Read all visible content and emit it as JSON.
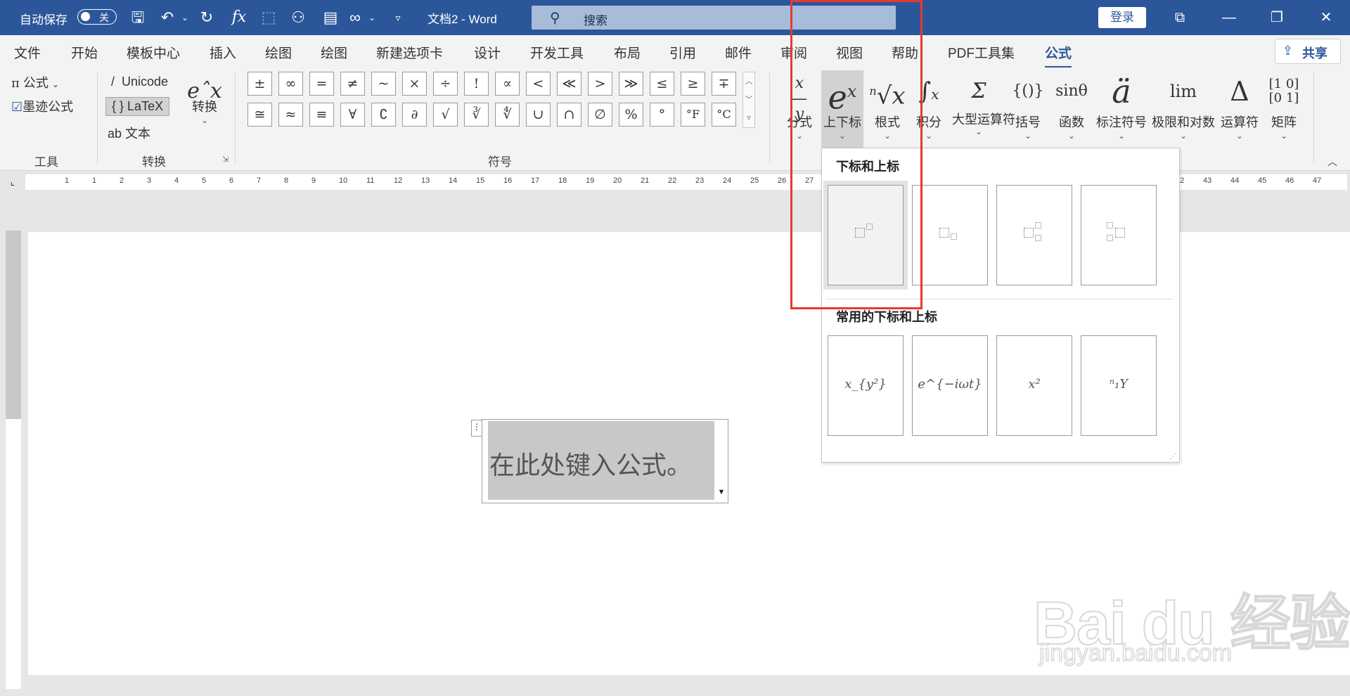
{
  "titlebar": {
    "autosave_label": "自动保存",
    "autosave_state": "关",
    "doc_title": "文档2  -  Word",
    "search_placeholder": "搜索",
    "login_label": "登录"
  },
  "tabs": [
    "文件",
    "开始",
    "模板中心",
    "插入",
    "绘图",
    "绘图",
    "新建选项卡",
    "设计",
    "开发工具",
    "布局",
    "引用",
    "邮件",
    "审阅",
    "视图",
    "帮助",
    "PDF工具集",
    "公式"
  ],
  "active_tab": "公式",
  "share_label": "共享",
  "ribbon": {
    "tools": {
      "formula_label": "公式",
      "ink_label": "墨迹公式",
      "group_label": "工具"
    },
    "convert": {
      "unicode_label": "Unicode",
      "latex_label": "LaTeX",
      "text_label": "文本",
      "convert_label": "转换",
      "group_label": "转换"
    },
    "symbols": {
      "row1": [
        "±",
        "∞",
        "=",
        "≠",
        "~",
        "×",
        "÷",
        "!",
        "∝",
        "<",
        "≪",
        ">",
        "≫",
        "≤",
        "≥",
        "∓"
      ],
      "row2": [
        "≅",
        "≈",
        "≡",
        "∀",
        "∁",
        "∂",
        "√",
        "∛",
        "∜",
        "∪",
        "∩",
        "∅",
        "%",
        "°",
        "°F",
        "°C"
      ],
      "group_label": "符号"
    },
    "structures": [
      {
        "label": "分式",
        "glyph": "x/y"
      },
      {
        "label": "上下标",
        "glyph": "eˣ"
      },
      {
        "label": "根式",
        "glyph": "ⁿ√x"
      },
      {
        "label": "积分",
        "glyph": "∫x −x"
      },
      {
        "label": "大型运算符",
        "glyph": "Σ"
      },
      {
        "label": "括号",
        "glyph": "{()}"
      },
      {
        "label": "函数",
        "glyph": "sinθ"
      },
      {
        "label": "标注符号",
        "glyph": "ä"
      },
      {
        "label": "极限和对数",
        "glyph": "lim"
      },
      {
        "label": "运算符",
        "glyph": "Δ"
      },
      {
        "label": "矩阵",
        "glyph": "[10 01]"
      }
    ]
  },
  "ruler_numbers": [
    "1",
    "1",
    "2",
    "3",
    "4",
    "5",
    "6",
    "7",
    "8",
    "9",
    "10",
    "11",
    "12",
    "13",
    "14",
    "15",
    "16",
    "17",
    "18",
    "19",
    "20",
    "21",
    "22",
    "23",
    "24",
    "25",
    "26",
    "27",
    "2",
    "42",
    "43",
    "44",
    "45",
    "46",
    "47"
  ],
  "dropdown": {
    "section1_title": "下标和上标",
    "section2_title": "常用的下标和上标",
    "common": [
      "x_{y²}",
      "e^{−iωt}",
      "x²",
      "ⁿ₁Y"
    ]
  },
  "equation_placeholder": "在此处键入公式。",
  "watermark": {
    "logo_text": "Bai du 经验",
    "url": "jingyan.baidu.com"
  },
  "colors": {
    "brand": "#2b579a",
    "highlight": "#e53935"
  }
}
